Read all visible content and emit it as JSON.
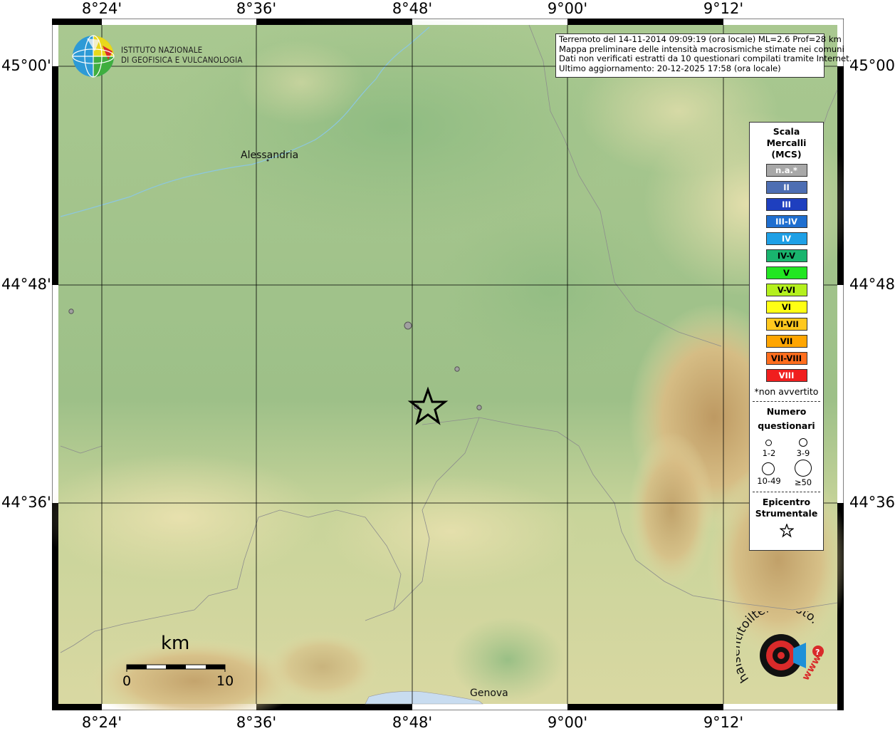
{
  "map": {
    "top_lon_labels": [
      "8°24'",
      "8°36'",
      "8°48'",
      "9°00'",
      "9°12'"
    ],
    "bottom_lon_labels": [
      "8°24'",
      "8°36'",
      "8°48'",
      "9°00'",
      "9°12'"
    ],
    "left_lat_labels": [
      "45°00'",
      "44°48'",
      "44°36'"
    ],
    "right_lat_labels": [
      "45°00'",
      "44°48'",
      "44°36'"
    ],
    "cities": [
      {
        "name": "Alessandria"
      },
      {
        "name": "Genova"
      }
    ]
  },
  "logo": {
    "line1": "ISTITUTO NAZIONALE",
    "line2": "DI GEOFISICA E VULCANOLOGIA"
  },
  "info": {
    "line1": "Terremoto del 14-11-2014 09:09:19 (ora locale) ML=2.6 Prof=28 km",
    "line2": "Mappa preliminare delle intensità macrosismiche stimate nei comuni",
    "line3": "Dati non verificati estratti da 10 questionari compilati tramite Internet.",
    "line4": "Ultimo aggiornamento: 20-12-2025 17:58 (ora locale)"
  },
  "legend": {
    "title1": "Scala",
    "title2": "Mercalli",
    "title3": "(MCS)",
    "scale": [
      {
        "label": "n.a.*",
        "color": "#a8a8a8",
        "text": "#ffffff"
      },
      {
        "label": "II",
        "color": "#4d6eb3",
        "text": "#ffffff"
      },
      {
        "label": "III",
        "color": "#1e3fbf",
        "text": "#ffffff"
      },
      {
        "label": "III-IV",
        "color": "#1f6fd0",
        "text": "#ffffff"
      },
      {
        "label": "IV",
        "color": "#1ea0e6",
        "text": "#ffffff"
      },
      {
        "label": "IV-V",
        "color": "#19b46e",
        "text": "#000000"
      },
      {
        "label": "V",
        "color": "#22e622",
        "text": "#000000"
      },
      {
        "label": "V-VI",
        "color": "#b4f01e",
        "text": "#000000"
      },
      {
        "label": "VI",
        "color": "#ffff14",
        "text": "#000000"
      },
      {
        "label": "VI-VII",
        "color": "#ffc81e",
        "text": "#000000"
      },
      {
        "label": "VII",
        "color": "#ffa500",
        "text": "#000000"
      },
      {
        "label": "VII-VIII",
        "color": "#ff6e1e",
        "text": "#000000"
      },
      {
        "label": "VIII",
        "color": "#f01e1e",
        "text": "#ffffff"
      }
    ],
    "note": "*non avvertito",
    "count_title1": "Numero",
    "count_title2": "questionari",
    "counts": [
      "1-2",
      "3-9",
      "10-49",
      "≥50"
    ],
    "epi_title1": "Epicentro",
    "epi_title2": "Strumentale"
  },
  "scalebar": {
    "unit": "km",
    "start": "0",
    "end": "10"
  },
  "hsit_logo": {
    "text": "haisentitoilterremoto.it",
    "www": "www."
  },
  "colors": {
    "plain_green": "#9dbf84",
    "hill_beige": "#e8e0a8",
    "mountain_brown": "#c9a066",
    "sea": "#c8dcf0"
  }
}
